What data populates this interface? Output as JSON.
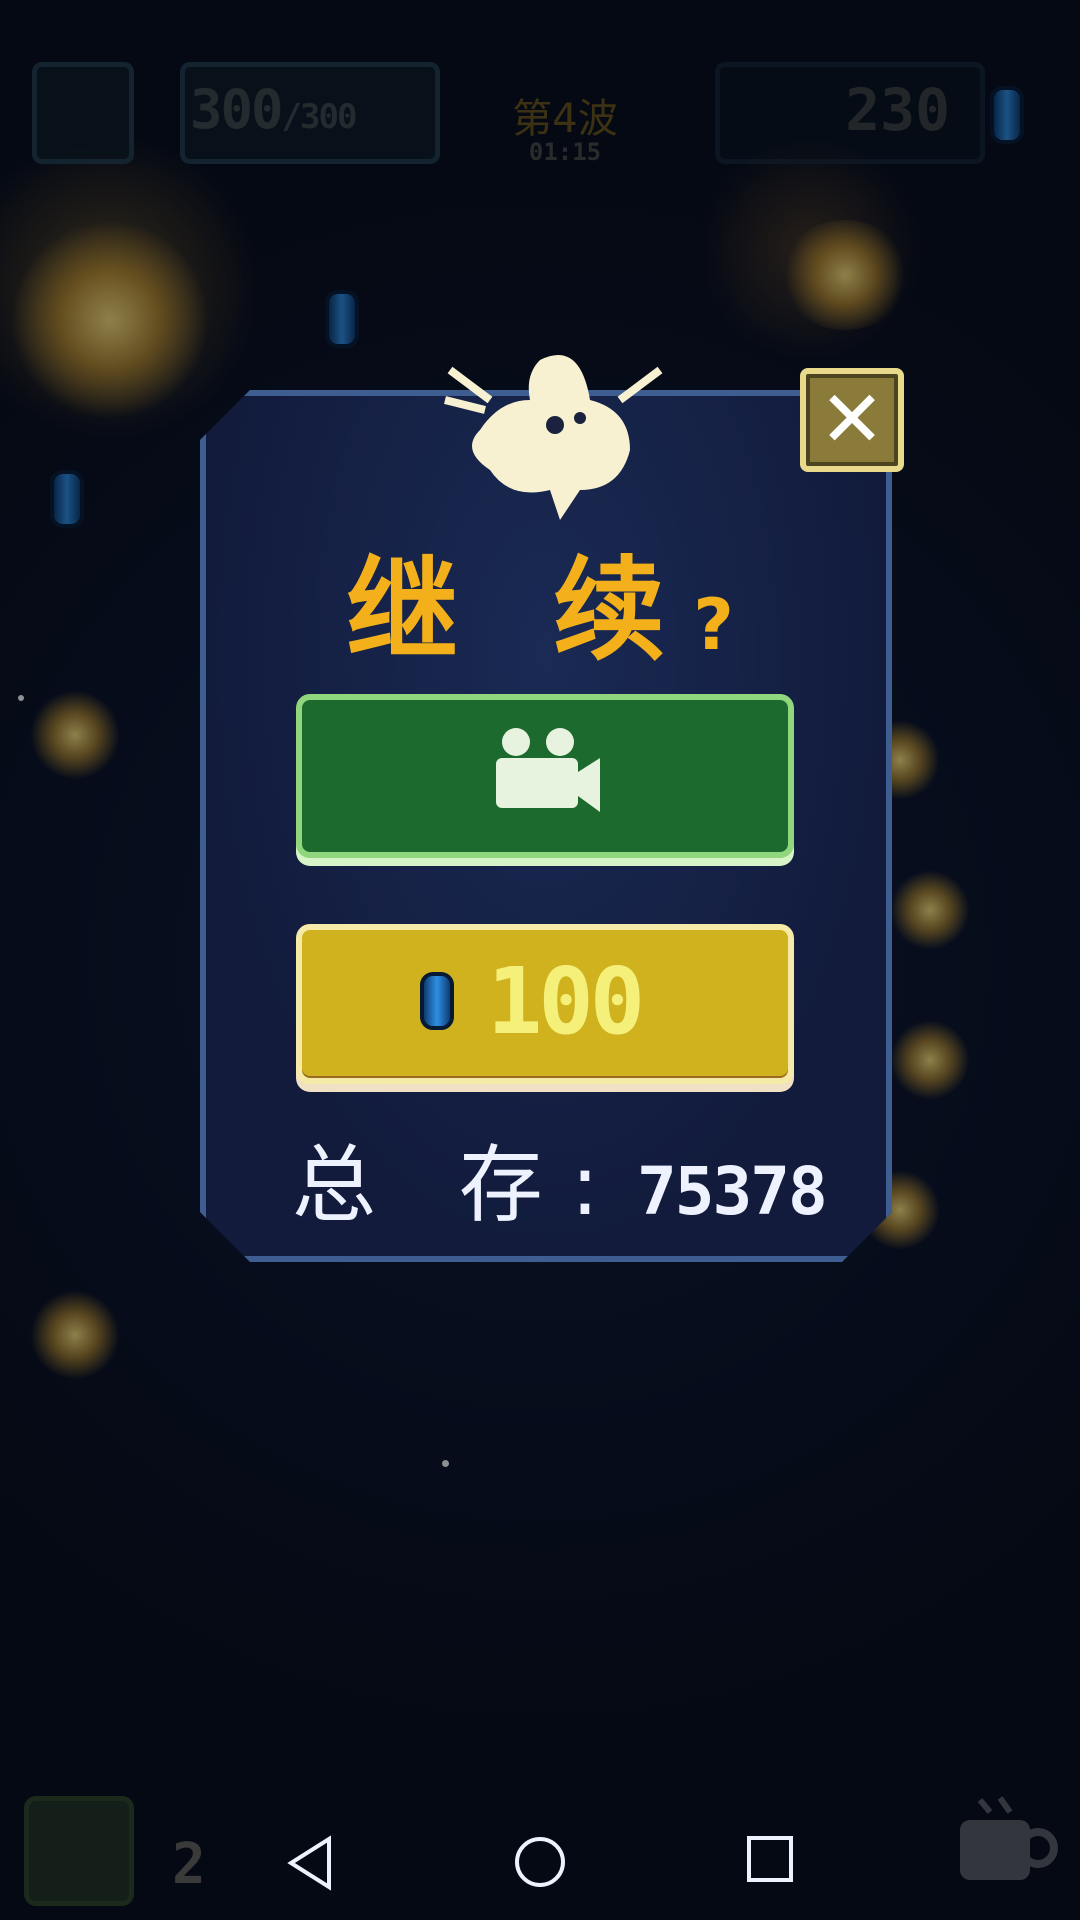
{
  "hud": {
    "health_current": "300",
    "health_max": "/300",
    "wave_label": "第4波",
    "wave_timer": "01:15",
    "gem_count": "230"
  },
  "continue_dialog": {
    "title": "继 续",
    "title_mark": "?",
    "watch_video_icon": "video-camera-icon",
    "gem_cost": "100",
    "total_label": "总 存:",
    "total_gems": "75378",
    "close_icon": "close-icon"
  },
  "bottom_bar": {
    "item_count": "2"
  },
  "nav": {
    "back": "back-icon",
    "home": "home-icon",
    "recent": "recent-apps-icon"
  },
  "colors": {
    "title": "#f4b01a",
    "video_button": "#1d6a2e",
    "gem_button": "#cfb21e",
    "panel": "#141f42",
    "panel_border": "#3e5e92"
  }
}
